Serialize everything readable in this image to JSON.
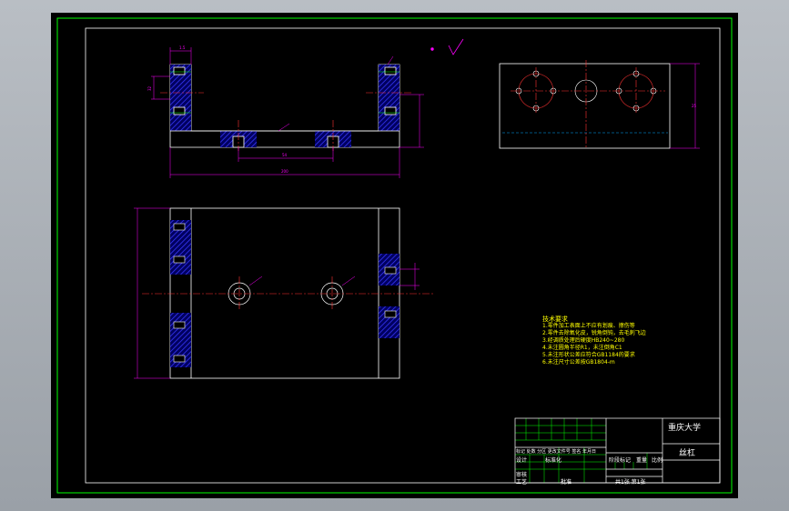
{
  "title_block": {
    "school": "重庆大学",
    "part_name": "丝杠",
    "row_marks": "标记 处数 分区 更改文件号 签名 年月日",
    "row_design": "设计",
    "row_stdz": "标准化",
    "row_review": "审核",
    "row_process": "工艺",
    "row_approve": "批准",
    "stage_mark": "阶段标记",
    "weight": "重量",
    "scale": "比例",
    "sheets": "共1张 第1张"
  },
  "notes": {
    "title": "技术要求",
    "lines": [
      "1.零件加工表面上不应有划痕、擦伤等",
      "2.零件去除氧化皮，锐角倒钝，去毛刺飞边",
      "3.经调质处理后硬度HB240~280",
      "4.未注圆角半径R1，未注倒角C1",
      "5.未注形状公差应符合GB1184的要求",
      "6.未注尺寸公差按GB1804-m"
    ]
  },
  "dims": {
    "left_width": "1.5",
    "height": "32",
    "span": "54",
    "overall": "200",
    "depth": "25"
  },
  "colors": {
    "line_white": "#ffffff",
    "centerline": "#ff3333",
    "dimension": "#ff00ff",
    "hatch": "#0000cc",
    "hidden": "#00aaff",
    "notes": "#ffff00",
    "frame": "#00ff00",
    "thread": "#00ff00"
  }
}
